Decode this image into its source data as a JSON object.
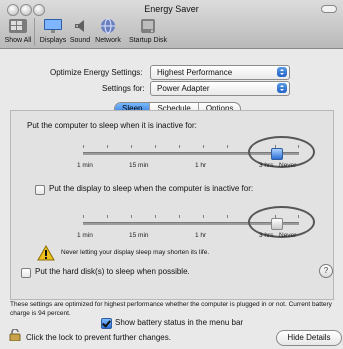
{
  "window": {
    "title": "Energy Saver",
    "toolbar": [
      "Show All",
      "Displays",
      "Sound",
      "Network",
      "Startup Disk"
    ]
  },
  "settings": {
    "optimize_label": "Optimize Energy Settings:",
    "optimize_value": "Highest Performance",
    "settings_for_label": "Settings for:",
    "settings_for_value": "Power Adapter"
  },
  "tabs": [
    "Sleep",
    "Schedule",
    "Options"
  ],
  "sleep": {
    "computer_label": "Put the computer to sleep when it is inactive for:",
    "display_label": "Put the display to sleep when the computer is inactive for:",
    "scale": [
      "1 min",
      "15 min",
      "1 hr",
      "3 hrs",
      "Never"
    ],
    "warning": "Never letting your display sleep may shorten its life.",
    "hard_disk_label": "Put the hard disk(s) to sleep when possible.",
    "help": "?"
  },
  "info_text": "These settings are optimized for highest performance whether the computer is plugged in or not. Current battery charge is 94 percent.",
  "battery_status_label": "Show battery status in the menu bar",
  "footer": {
    "lock_text": "Click the lock to prevent further changes.",
    "hide_details": "Hide Details"
  }
}
